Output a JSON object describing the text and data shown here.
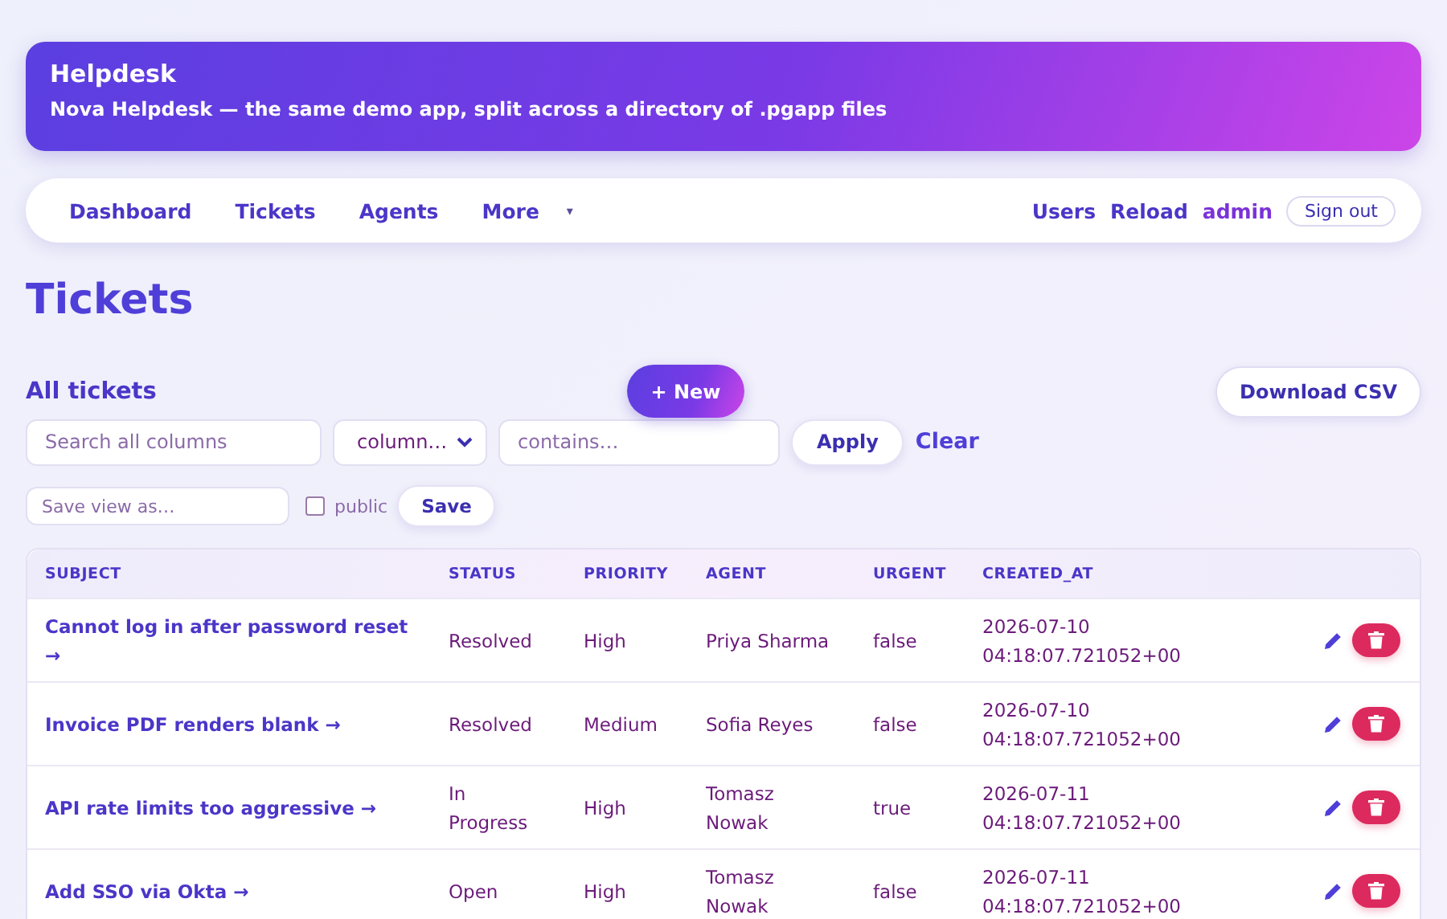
{
  "banner": {
    "title": "Helpdesk",
    "subtitle": "Nova Helpdesk — the same demo app, split across a directory of .pgapp files"
  },
  "nav": {
    "items": [
      {
        "label": "Dashboard"
      },
      {
        "label": "Tickets"
      },
      {
        "label": "Agents"
      },
      {
        "label": "More",
        "caret": "▾"
      }
    ],
    "right": [
      {
        "label": "Users",
        "kind": "link"
      },
      {
        "label": "Reload",
        "kind": "link"
      },
      {
        "label": "admin",
        "kind": "user"
      },
      {
        "label": "Sign out",
        "kind": "button"
      }
    ]
  },
  "page_title": "Tickets",
  "section_title": "All tickets",
  "new_button": "+ New",
  "download_button": "Download CSV",
  "filters": {
    "search_placeholder": "Search all columns",
    "column_select": "column…",
    "contains_placeholder": "contains…",
    "apply": "Apply",
    "clear": "Clear"
  },
  "save_view": {
    "placeholder": "Save view as…",
    "public_label": "public",
    "public_checked": false,
    "save": "Save"
  },
  "table": {
    "columns": [
      "SUBJECT",
      "STATUS",
      "PRIORITY",
      "AGENT",
      "URGENT",
      "CREATED_AT"
    ],
    "rows": [
      {
        "subject": "Cannot log in after password reset →",
        "status": "Resolved",
        "priority": "High",
        "agent": "Priya Sharma",
        "urgent": "false",
        "created_at": "2026-07-10 04:18:07.721052+00"
      },
      {
        "subject": "Invoice PDF renders blank →",
        "status": "Resolved",
        "priority": "Medium",
        "agent": "Sofia Reyes",
        "urgent": "false",
        "created_at": "2026-07-10 04:18:07.721052+00"
      },
      {
        "subject": "API rate limits too aggressive →",
        "status": "In Progress",
        "priority": "High",
        "agent": "Tomasz Nowak",
        "urgent": "true",
        "created_at": "2026-07-11 04:18:07.721052+00"
      },
      {
        "subject": "Add SSO via Okta →",
        "status": "Open",
        "priority": "High",
        "agent": "Tomasz Nowak",
        "urgent": "false",
        "created_at": "2026-07-11 04:18:07.721052+00"
      }
    ]
  }
}
